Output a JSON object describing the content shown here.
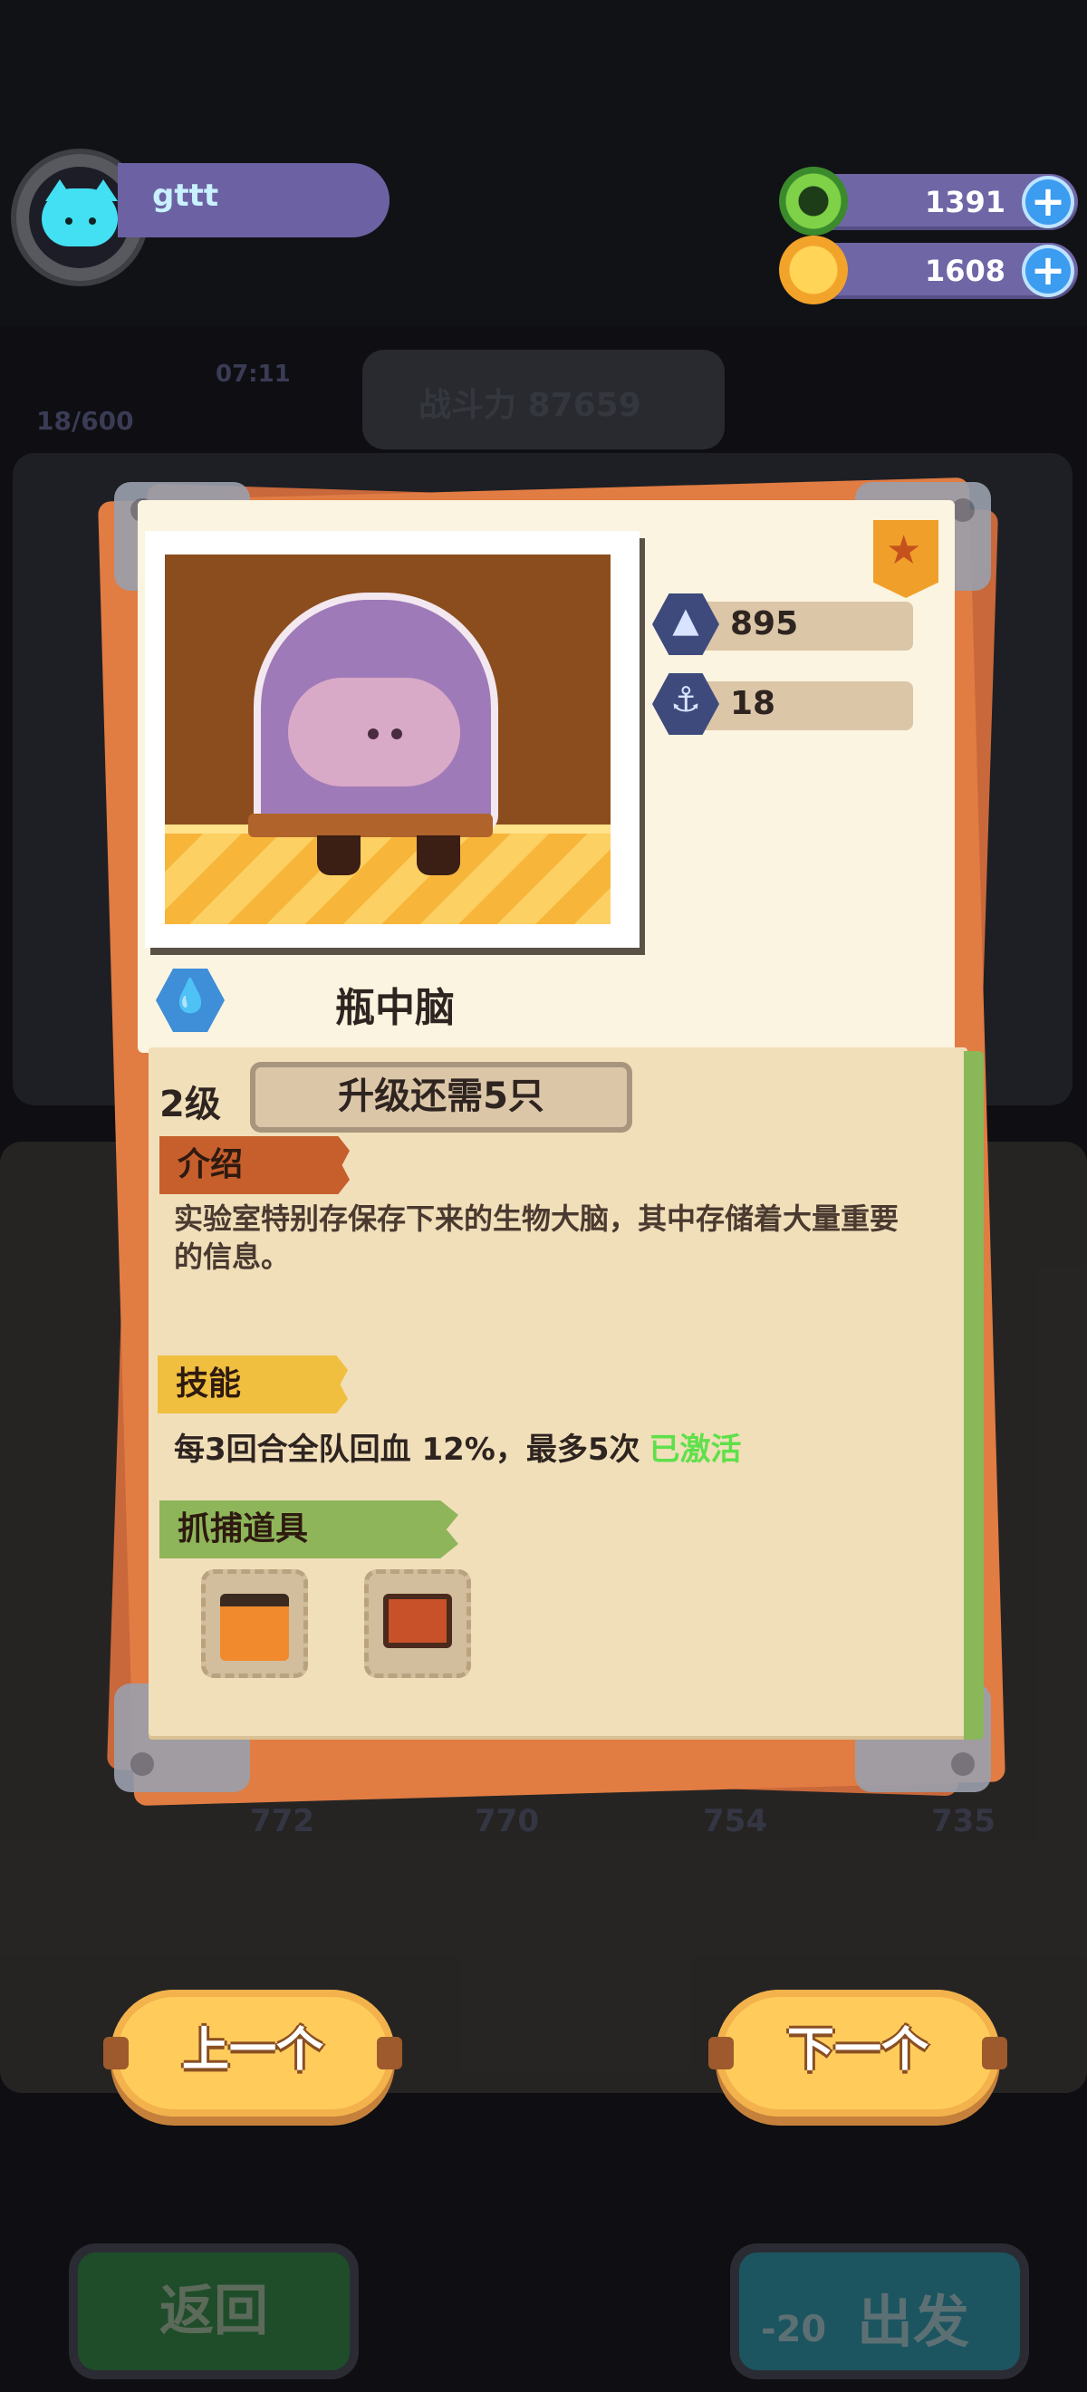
{
  "player": {
    "name": "gttt"
  },
  "resources": [
    {
      "icon": "green-ring-currency-icon",
      "value": "1391"
    },
    {
      "icon": "gold-planet-coin-icon",
      "value": "1608"
    }
  ],
  "background": {
    "energy": "18/600",
    "timer": "07:11",
    "power_label": "战斗力 87659",
    "card_powers": [
      "772",
      "770",
      "754",
      "735"
    ],
    "back_label": "返回",
    "go_label": "出发",
    "go_cost": "-20"
  },
  "creature": {
    "name": "瓶中脑",
    "element_icon": "water-drop-icon",
    "rank_icon": "star-badge-icon",
    "stats": [
      {
        "icon": "attack-rocket-icon",
        "value": "895"
      },
      {
        "icon": "defense-anchor-icon",
        "value": "18"
      }
    ],
    "level": "2级",
    "upgrade_text": "升级还需5只",
    "intro_title": "介绍",
    "intro_text": "实验室特别存保存下来的生物大脑，其中存储着大量重要的信息。",
    "skill_title": "技能",
    "skill_text": "每3回合全队回血 12%，最多5次",
    "skill_status": "已激活",
    "tools_title": "抓捕道具",
    "tools": [
      "orange-capture-box-icon",
      "red-cage-box-icon"
    ]
  },
  "nav": {
    "prev_label": "上一个",
    "next_label": "下一个"
  },
  "colors": {
    "intro_ribbon": "#c65f2c",
    "skill_ribbon": "#f0bf3f",
    "tools_ribbon": "#8fb55a",
    "skill_active": "#5fe04a"
  }
}
